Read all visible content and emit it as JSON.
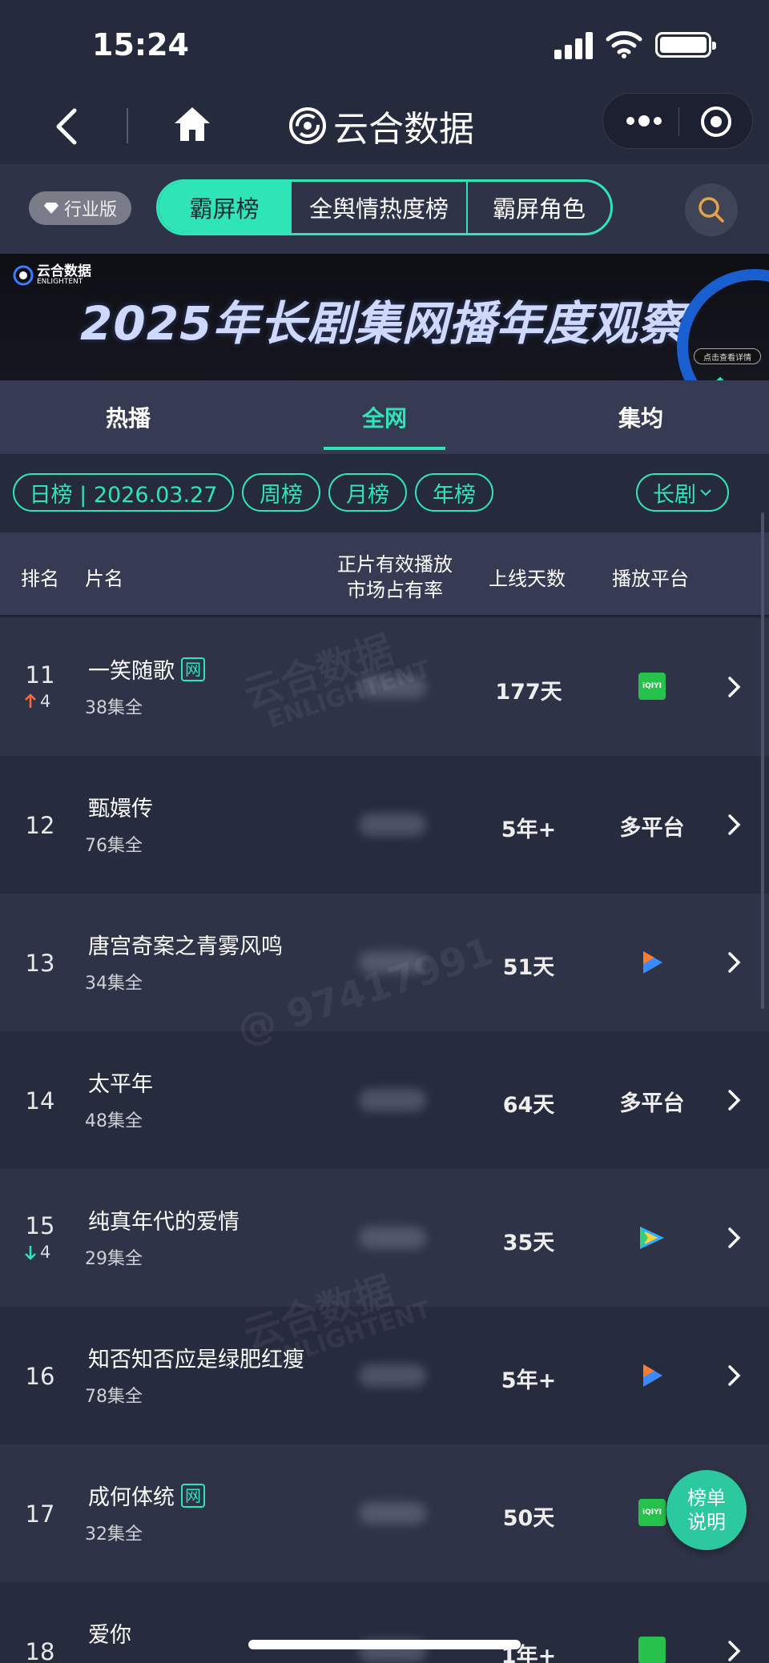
{
  "status_bar": {
    "time": "15:24"
  },
  "nav": {
    "brand": "云合数据"
  },
  "filter_bar": {
    "industry_label": "行业版",
    "segments": [
      "霸屏榜",
      "全舆情热度榜",
      "霸屏角色"
    ],
    "active_segment": "霸屏榜"
  },
  "banner": {
    "logo_cn": "云合数据",
    "logo_en": "ENLIGHTENT",
    "title": "2025年长剧集网播年度观察",
    "cta": "点击查看详情"
  },
  "tabs": {
    "items": [
      "热播",
      "全网",
      "集均"
    ],
    "active": "全网"
  },
  "chips": {
    "daily": "日榜 | 2026.03.27",
    "weekly": "周榜",
    "monthly": "月榜",
    "yearly": "年榜",
    "category": "长剧"
  },
  "table_header": {
    "rank": "排名",
    "name": "片名",
    "share_line1": "正片有效播放",
    "share_line2": "市场占有率",
    "days": "上线天数",
    "platform": "播放平台"
  },
  "rows": [
    {
      "rank": "11",
      "change_dir": "up",
      "change": "4",
      "title": "一笑随歌",
      "badge": "网",
      "episodes": "38集全",
      "days": "177天",
      "platform": "iqiyi-icon",
      "platform_text": "iQIYI"
    },
    {
      "rank": "12",
      "change_dir": "",
      "change": "",
      "title": "甄嬛传",
      "badge": "",
      "episodes": "76集全",
      "days": "5年+",
      "platform": "text",
      "platform_text": "多平台"
    },
    {
      "rank": "13",
      "change_dir": "",
      "change": "",
      "title": "唐宫奇案之青雾风鸣",
      "badge": "",
      "episodes": "34集全",
      "days": "51天",
      "platform": "youku-icon",
      "platform_text": ""
    },
    {
      "rank": "14",
      "change_dir": "",
      "change": "",
      "title": "太平年",
      "badge": "",
      "episodes": "48集全",
      "days": "64天",
      "platform": "text",
      "platform_text": "多平台"
    },
    {
      "rank": "15",
      "change_dir": "down",
      "change": "4",
      "title": "纯真年代的爱情",
      "badge": "",
      "episodes": "29集全",
      "days": "35天",
      "platform": "tencent-video-icon",
      "platform_text": ""
    },
    {
      "rank": "16",
      "change_dir": "",
      "change": "",
      "title": "知否知否应是绿肥红瘦",
      "badge": "",
      "episodes": "78集全",
      "days": "5年+",
      "platform": "youku-icon",
      "platform_text": ""
    },
    {
      "rank": "17",
      "change_dir": "",
      "change": "",
      "title": "成何体统",
      "badge": "网",
      "episodes": "32集全",
      "days": "50天",
      "platform": "iqiyi-icon",
      "platform_text": "iQIYI"
    },
    {
      "rank": "18",
      "change_dir": "",
      "change": "",
      "title": "爱你",
      "badge": "",
      "episodes": "",
      "days": "1年+",
      "platform": "iqiyi-icon",
      "platform_text": ""
    }
  ],
  "watermarks": [
    "云合数据",
    "ENLIGHTENT",
    "@ 97417991"
  ],
  "fab": {
    "line1": "榜单",
    "line2": "说明"
  },
  "colors": {
    "accent": "#2fe5b7",
    "background": "#262a3d",
    "up": "#ff6a3d",
    "down": "#2fe5b7"
  }
}
